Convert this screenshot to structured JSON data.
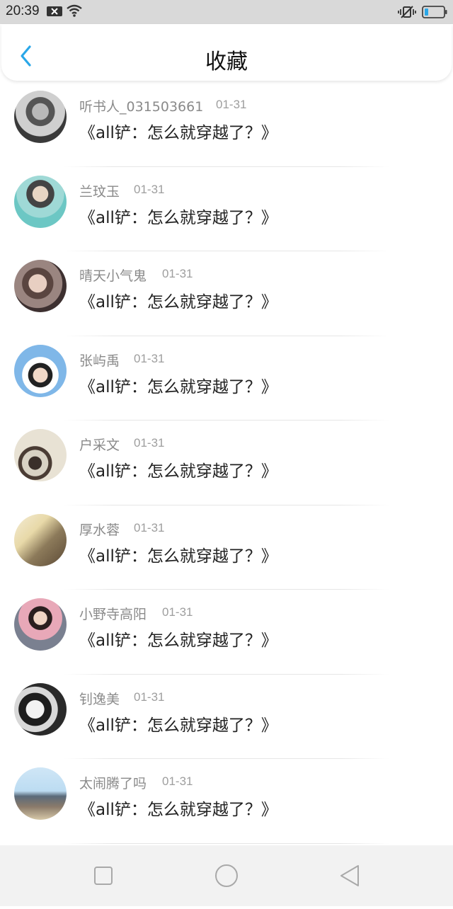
{
  "status": {
    "time": "20:39"
  },
  "header": {
    "title": "收藏"
  },
  "items": [
    {
      "name": "听书人_031503661",
      "date": "01-31",
      "book": "《all铲：怎么就穿越了？》"
    },
    {
      "name": "兰玟玉",
      "date": "01-31",
      "book": "《all铲：怎么就穿越了？》"
    },
    {
      "name": "晴天小气鬼",
      "date": "01-31",
      "book": "《all铲：怎么就穿越了？》"
    },
    {
      "name": "张屿禹",
      "date": "01-31",
      "book": "《all铲：怎么就穿越了？》"
    },
    {
      "name": "户采文",
      "date": "01-31",
      "book": "《all铲：怎么就穿越了？》"
    },
    {
      "name": "厚水蓉",
      "date": "01-31",
      "book": "《all铲：怎么就穿越了？》"
    },
    {
      "name": "小野寺高阳",
      "date": "01-31",
      "book": "《all铲：怎么就穿越了？》"
    },
    {
      "name": "钊逸美",
      "date": "01-31",
      "book": "《all铲：怎么就穿越了？》"
    },
    {
      "name": "太闹腾了吗",
      "date": "01-31",
      "book": "《all铲：怎么就穿越了？》"
    }
  ],
  "icons": {
    "back": "chevron-left-icon",
    "nav": [
      "square-recent-icon",
      "circle-home-icon",
      "triangle-back-icon"
    ]
  },
  "colors": {
    "accent": "#2aa7e8"
  }
}
